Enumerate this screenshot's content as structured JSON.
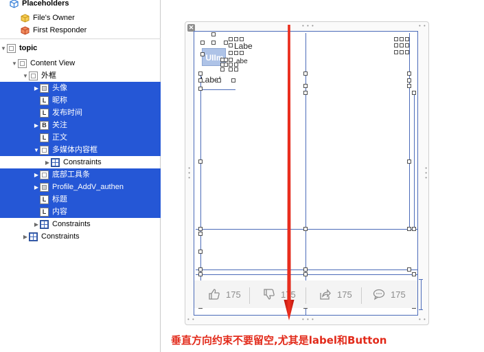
{
  "outline": {
    "placeholders_header": "Placeholders",
    "files_owner": "File's Owner",
    "first_responder": "First Responder",
    "topic": "topic",
    "content_view": "Content View",
    "outer_frame": "外框",
    "children": [
      {
        "label": "头像",
        "icon": "image-view-icon",
        "expand": true,
        "selected": true
      },
      {
        "label": "昵称",
        "icon": "label-icon",
        "expand": false,
        "selected": true
      },
      {
        "label": "发布时间",
        "icon": "label-icon",
        "expand": false,
        "selected": true
      },
      {
        "label": "关注",
        "icon": "button-icon",
        "expand": true,
        "selected": true
      },
      {
        "label": "正文",
        "icon": "label-icon",
        "expand": false,
        "selected": true
      },
      {
        "label": "多媒体内容框",
        "icon": "view-icon",
        "expand": true,
        "selected": true
      }
    ],
    "media_constraints": "Constraints",
    "children2": [
      {
        "label": "底部工具条",
        "icon": "view-icon",
        "expand": true,
        "selected": true
      },
      {
        "label": "Profile_AddV_authen",
        "icon": "image-view-icon",
        "expand": true,
        "selected": true
      },
      {
        "label": "标题",
        "icon": "label-icon",
        "expand": false,
        "selected": true
      },
      {
        "label": "内容",
        "icon": "label-icon",
        "expand": false,
        "selected": true
      }
    ],
    "outer_constraints": "Constraints",
    "content_constraints": "Constraints",
    "selection_color": "#2557d6"
  },
  "canvas": {
    "avatar_text": "UIIm",
    "label_1": "Labe",
    "label_2": "abe",
    "label_3": "Label",
    "toolbar": [
      {
        "icon": "thumbs-up-icon",
        "count": "175"
      },
      {
        "icon": "thumbs-down-icon",
        "count": "175"
      },
      {
        "icon": "share-icon",
        "count": "175"
      },
      {
        "icon": "comment-icon",
        "count": "175"
      }
    ],
    "arrow_color": "#e8251a"
  },
  "caption": "垂直方向约束不要留空,尤其是label和Button"
}
